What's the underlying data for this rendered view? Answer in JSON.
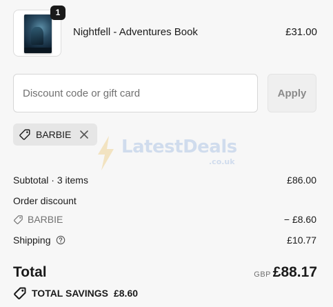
{
  "product": {
    "name": "Nightfell - Adventures Book",
    "price": "£31.00",
    "quantity": "1",
    "image_icon": "book-cover"
  },
  "discount": {
    "placeholder": "Discount code or gift card",
    "value": "",
    "apply_label": "Apply",
    "applied_code": "BARBIE",
    "remove_icon": "close-icon",
    "tag_icon": "tag-icon"
  },
  "watermark": {
    "brand": "LatestDeals",
    "suffix": ".co.uk"
  },
  "summary": {
    "subtotal_label": "Subtotal · 3 items",
    "subtotal_value": "£86.00",
    "order_discount_label": "Order discount",
    "discount_code": "BARBIE",
    "discount_value": "− £8.60",
    "shipping_label": "Shipping",
    "shipping_value": "£10.77",
    "help_icon": "question-circle-icon"
  },
  "total": {
    "label": "Total",
    "currency": "GBP",
    "amount": "£88.17"
  },
  "savings": {
    "label": "TOTAL SAVINGS",
    "amount": "£8.60"
  },
  "colors": {
    "background": "#f7f7f7",
    "text": "#1a1a1a",
    "muted": "#707070",
    "chip": "#e6e6e6"
  }
}
